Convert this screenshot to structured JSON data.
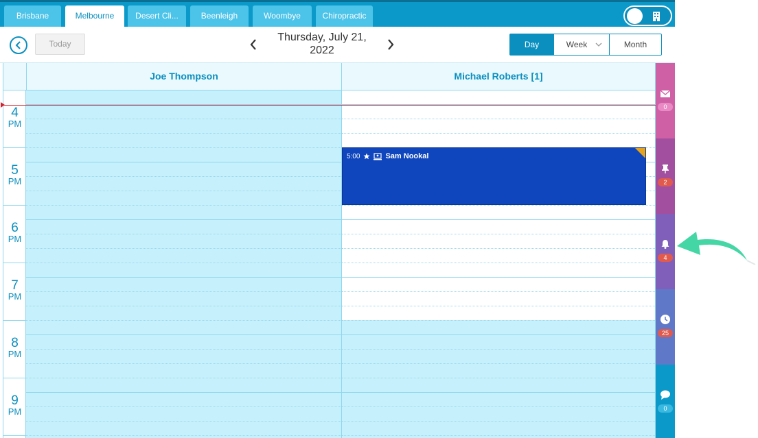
{
  "tabs": [
    {
      "label": "Brisbane"
    },
    {
      "label": "Melbourne"
    },
    {
      "label": "Desert Cli..."
    },
    {
      "label": "Beenleigh"
    },
    {
      "label": "Woombye"
    },
    {
      "label": "Chiropractic"
    }
  ],
  "active_tab": "Melbourne",
  "header": {
    "today_label": "Today",
    "date_line1": "Thursday, July 21,",
    "date_line2": "2022"
  },
  "views": {
    "day": "Day",
    "week": "Week",
    "month": "Month",
    "active": "Day"
  },
  "columns": [
    {
      "name": "Joe Thompson"
    },
    {
      "name": "Michael Roberts [1]"
    }
  ],
  "hours": [
    {
      "num": "4",
      "period": "PM"
    },
    {
      "num": "5",
      "period": "PM"
    },
    {
      "num": "6",
      "period": "PM"
    },
    {
      "num": "7",
      "period": "PM"
    },
    {
      "num": "8",
      "period": "PM"
    },
    {
      "num": "9",
      "period": "PM"
    }
  ],
  "appointment": {
    "time": "5:00",
    "patient": "Sam Nookal"
  },
  "sidebar": [
    {
      "icon": "envelope-icon",
      "count": "0",
      "color": "#d060a5",
      "badge_color": "#e98ac4"
    },
    {
      "icon": "pin-icon",
      "count": "2",
      "color": "#a34f9f",
      "badge_color": "#e05a4e"
    },
    {
      "icon": "bell-icon",
      "count": "4",
      "color": "#7f5fba",
      "badge_color": "#e05a4e"
    },
    {
      "icon": "clock-icon",
      "count": "25",
      "color": "#5f78c8",
      "badge_color": "#e05a4e"
    },
    {
      "icon": "chat-icon",
      "count": "0",
      "color": "#0a99c9",
      "badge_color": "#39b8e0"
    }
  ],
  "colors": {
    "accent": "#0a8fbf",
    "appointment": "#0f46bd",
    "now_line": "#d61f2c",
    "callout_arrow": "#45d6a6"
  }
}
